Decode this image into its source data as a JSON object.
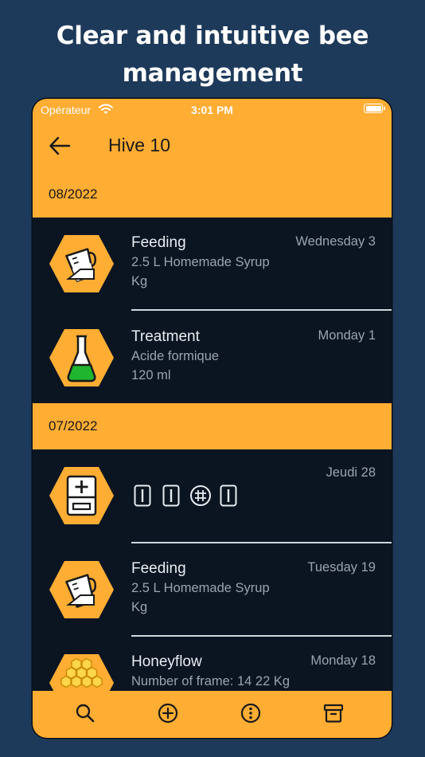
{
  "headline": {
    "line1": "Clear and intuitive bee",
    "line2": "management"
  },
  "status_bar": {
    "carrier": "Opérateur",
    "time": "3:01 PM"
  },
  "header": {
    "title": "Hive 10"
  },
  "sections": [
    {
      "month": "08/2022",
      "entries": [
        {
          "icon": "measuring-cup-icon",
          "title": "Feeding",
          "line1": "2.5 L Homemade Syrup",
          "line2": "Kg",
          "date": "Wednesday 3"
        },
        {
          "icon": "flask-icon",
          "title": "Treatment",
          "line1": "Acide formique",
          "line2": "120 ml",
          "date": "Monday 1"
        }
      ]
    },
    {
      "month": "07/2022",
      "entries": [
        {
          "icon": "hive-box-icon",
          "date": "Jeudi 28",
          "frame_symbols": [
            "frame-bar-icon",
            "frame-bar-icon",
            "frame-grid-icon",
            "frame-bar-icon"
          ]
        },
        {
          "icon": "measuring-cup-icon",
          "title": "Feeding",
          "line1": "2.5 L Homemade Syrup",
          "line2": "Kg",
          "date": "Tuesday 19"
        },
        {
          "icon": "honeycomb-icon",
          "title": "Honeyflow",
          "line1": "Number of frame: 14 22 Kg",
          "date": "Monday 18"
        }
      ]
    }
  ],
  "bottom_bar": {
    "tabs": [
      "search-icon",
      "add-icon",
      "more-icon",
      "archive-icon"
    ]
  },
  "colors": {
    "background": "#1e3a5a",
    "accent": "#ffad33",
    "list_background": "#0b1522",
    "text_primary": "#e9edf2",
    "text_secondary": "#9aa3ae",
    "treatment_liquid": "#1fb52e"
  }
}
